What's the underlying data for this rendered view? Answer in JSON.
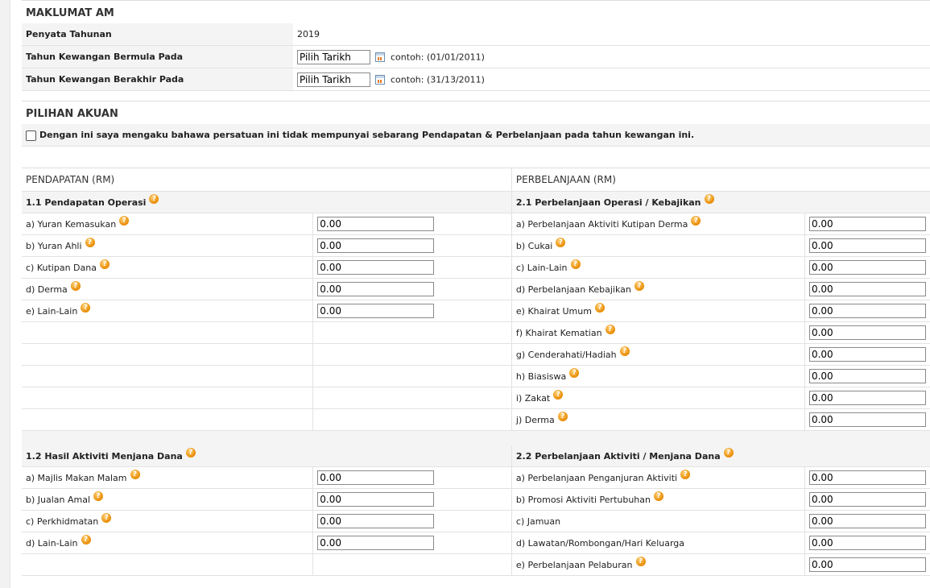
{
  "maklumat_am": {
    "title": "MAKLUMAT AM",
    "rows": [
      {
        "label": "Penyata Tahunan",
        "value": "2019"
      },
      {
        "label": "Tahun Kewangan Bermula Pada",
        "date_value": "Pilih Tarikh",
        "hint": "contoh: (01/01/2011)"
      },
      {
        "label": "Tahun Kewangan Berakhir Pada",
        "date_value": "Pilih Tarikh",
        "hint": "contoh: (31/13/2011)"
      }
    ]
  },
  "pilihan_akuan": {
    "title": "PILIHAN AKUAN",
    "checkbox_label": "Dengan ini saya mengaku bahawa persatuan ini tidak mempunyai sebarang Pendapatan & Perbelanjaan pada tahun kewangan ini.",
    "checked": false
  },
  "pendapatan": {
    "title": "PENDAPATAN (RM)",
    "s11_title": "1.1 Pendapatan Operasi",
    "s11_items": [
      {
        "label": "a) Yuran Kemasukan",
        "value": "0.00"
      },
      {
        "label": "b) Yuran Ahli",
        "value": "0.00"
      },
      {
        "label": "c) Kutipan Dana",
        "value": "0.00"
      },
      {
        "label": "d) Derma",
        "value": "0.00"
      },
      {
        "label": "e) Lain-Lain",
        "value": "0.00"
      }
    ],
    "s12_title": "1.2 Hasil Aktiviti Menjana Dana",
    "s12_items": [
      {
        "label": "a) Majlis Makan Malam",
        "value": "0.00"
      },
      {
        "label": "b) Jualan Amal",
        "value": "0.00"
      },
      {
        "label": "c) Perkhidmatan",
        "value": "0.00"
      },
      {
        "label": "d) Lain-Lain",
        "value": "0.00"
      }
    ]
  },
  "perbelanjaan": {
    "title": "PERBELANJAAN (RM)",
    "s21_title": "2.1 Perbelanjaan Operasi / Kebajikan",
    "s21_items": [
      {
        "label": "a) Perbelanjaan Aktiviti Kutipan Derma",
        "value": "0.00"
      },
      {
        "label": "b) Cukai",
        "value": "0.00"
      },
      {
        "label": "c) Lain-Lain",
        "value": "0.00"
      },
      {
        "label": "d) Perbelanjaan Kebajikan",
        "value": "0.00"
      },
      {
        "label": "e) Khairat Umum",
        "value": "0.00"
      },
      {
        "label": "f) Khairat Kematian",
        "value": "0.00"
      },
      {
        "label": "g) Cenderahati/Hadiah",
        "value": "0.00"
      },
      {
        "label": "h) Biasiswa",
        "value": "0.00"
      },
      {
        "label": "i) Zakat",
        "value": "0.00"
      },
      {
        "label": "j) Derma",
        "value": "0.00"
      }
    ],
    "s22_title": "2.2 Perbelanjaan Aktiviti / Menjana Dana",
    "s22_items": [
      {
        "label": "a) Perbelanjaan Penganjuran Aktiviti",
        "value": "0.00"
      },
      {
        "label": "b) Promosi Aktiviti Pertubuhan",
        "value": "0.00"
      },
      {
        "label": "c) Jamuan",
        "value": "0.00"
      },
      {
        "label": "d) Lawatan/Rombongan/Hari Keluarga",
        "value": "0.00"
      },
      {
        "label": "e) Perbelanjaan Pelaburan",
        "value": "0.00"
      }
    ]
  },
  "icons": {
    "help": "help-question-icon",
    "calendar": "calendar-icon"
  },
  "colors": {
    "help_icon": "#e88a00",
    "row_bg": "#f4f4f4"
  }
}
